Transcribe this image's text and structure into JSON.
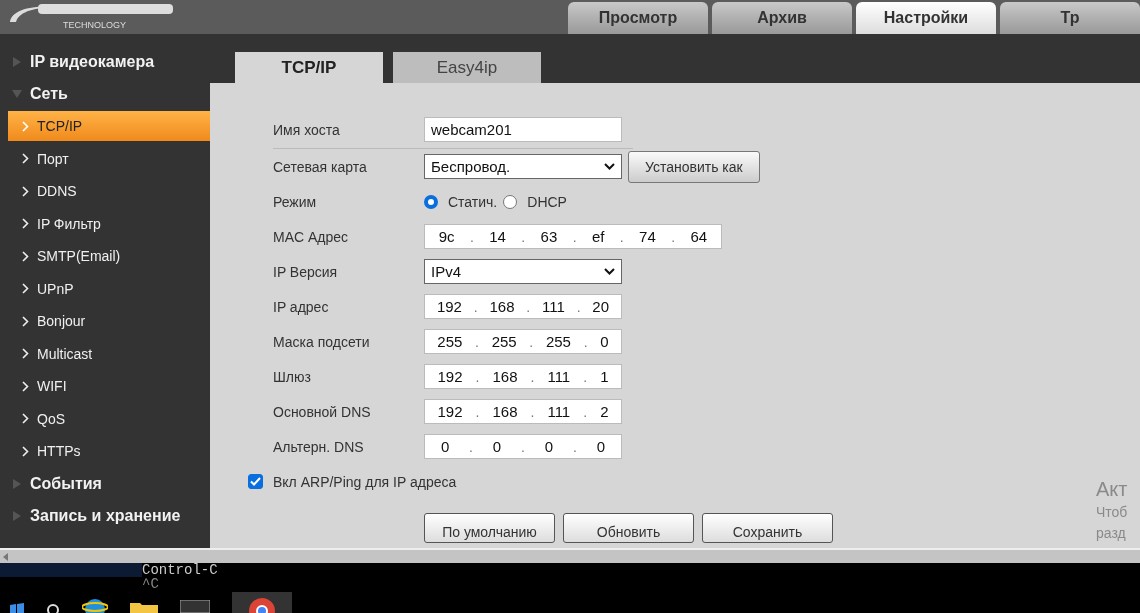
{
  "header": {
    "logo_subtitle": "TECHNOLOGY",
    "tabs": [
      {
        "label": "Просмотр",
        "selected": false
      },
      {
        "label": "Архив",
        "selected": false
      },
      {
        "label": "Настройки",
        "selected": true
      },
      {
        "label": "Тр",
        "selected": false
      }
    ]
  },
  "sidebar": {
    "items": [
      {
        "label": "IP видеокамера",
        "expanded": false
      },
      {
        "label": "Сеть",
        "expanded": true,
        "children": [
          {
            "label": "TCP/IP",
            "selected": true
          },
          {
            "label": "Порт",
            "selected": false
          },
          {
            "label": "DDNS",
            "selected": false
          },
          {
            "label": "IP Фильтр",
            "selected": false
          },
          {
            "label": "SMTP(Email)",
            "selected": false
          },
          {
            "label": "UPnP",
            "selected": false
          },
          {
            "label": "Bonjour",
            "selected": false
          },
          {
            "label": "Multicast",
            "selected": false
          },
          {
            "label": "WIFI",
            "selected": false
          },
          {
            "label": "QoS",
            "selected": false
          },
          {
            "label": "HTTPs",
            "selected": false
          }
        ]
      },
      {
        "label": "События",
        "expanded": false
      },
      {
        "label": "Запись и хранение",
        "expanded": false
      }
    ]
  },
  "content_tabs": [
    {
      "label": "TCP/IP",
      "selected": true
    },
    {
      "label": "Easy4ip",
      "selected": false
    }
  ],
  "form": {
    "rows": [
      {
        "kind": "text",
        "label": "Имя хоста",
        "value": "webcam201"
      },
      {
        "kind": "select",
        "label": "Сетевая карта",
        "value": "Беспровод.",
        "button": "Установить как"
      },
      {
        "kind": "radio",
        "label": "Режим",
        "options": [
          {
            "label": "Статич.",
            "selected": true
          },
          {
            "label": "DHCP",
            "selected": false
          }
        ]
      },
      {
        "kind": "mac",
        "label": "MAC Адрес",
        "parts": [
          "9c",
          "14",
          "63",
          "ef",
          "74",
          "64"
        ],
        "separator": "."
      },
      {
        "kind": "select",
        "label": "IP Версия",
        "value": "IPv4"
      },
      {
        "kind": "ip",
        "label": "IP адрес",
        "parts": [
          "192",
          "168",
          "111",
          "20"
        ],
        "separator": "."
      },
      {
        "kind": "ip",
        "label": "Маска подсети",
        "parts": [
          "255",
          "255",
          "255",
          "0"
        ],
        "separator": "."
      },
      {
        "kind": "ip",
        "label": "Шлюз",
        "parts": [
          "192",
          "168",
          "111",
          "1"
        ],
        "separator": "."
      },
      {
        "kind": "ip",
        "label": "Основной DNS",
        "parts": [
          "192",
          "168",
          "111",
          "2"
        ],
        "separator": "."
      },
      {
        "kind": "ip",
        "label": "Альтерн. DNS",
        "parts": [
          "0",
          "0",
          "0",
          "0"
        ],
        "separator": "."
      }
    ],
    "arp_ping": {
      "label": "Вкл ARP/Ping для IP адреса",
      "checked": true
    },
    "buttons": [
      "По умолчанию",
      "Обновить",
      "Сохранить"
    ]
  },
  "activation_notice": [
    "Акт",
    "Чтоб",
    "разд"
  ],
  "terminal": {
    "lines": [
      "Control-C",
      "^C"
    ]
  }
}
